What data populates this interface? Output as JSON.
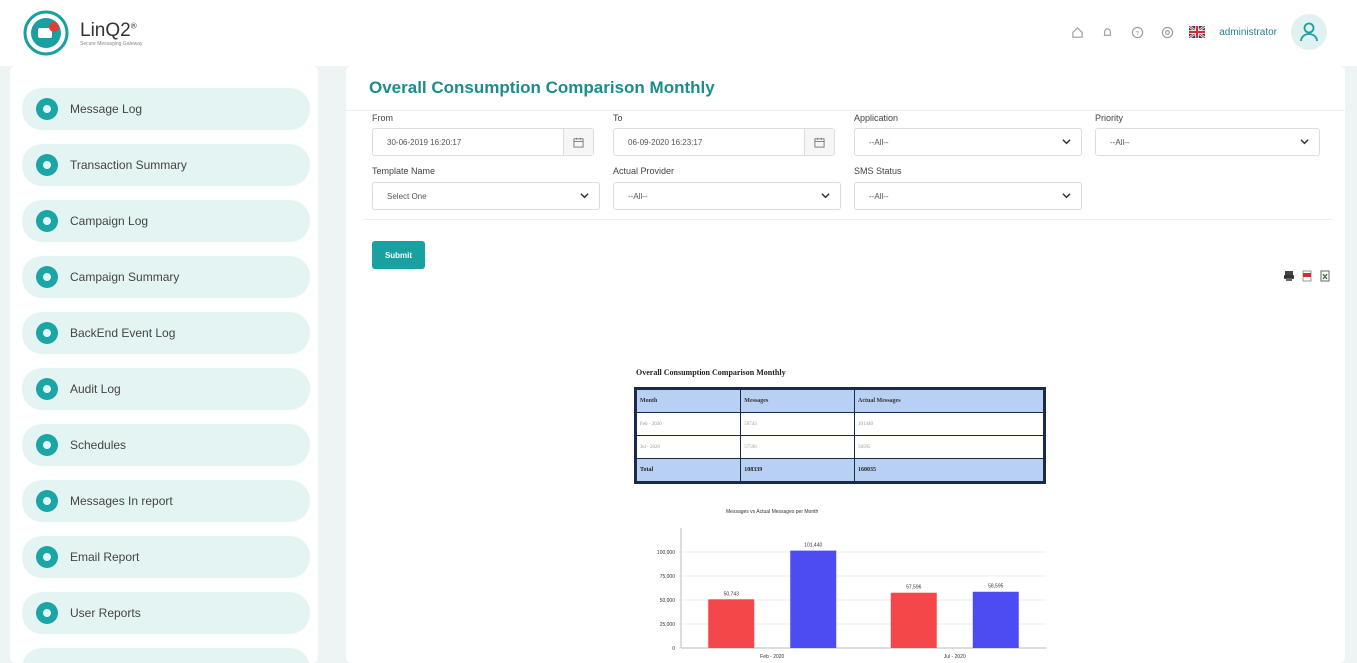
{
  "app": {
    "name": "LinQ2",
    "tagline": "Secure Messaging Gateway"
  },
  "header": {
    "user": "administrator"
  },
  "sidebar": {
    "items": [
      {
        "label": "Message Log"
      },
      {
        "label": "Transaction Summary"
      },
      {
        "label": "Campaign Log"
      },
      {
        "label": "Campaign Summary"
      },
      {
        "label": "BackEnd Event Log"
      },
      {
        "label": "Audit Log"
      },
      {
        "label": "Schedules"
      },
      {
        "label": "Messages In report"
      },
      {
        "label": "Email Report"
      },
      {
        "label": "User Reports"
      }
    ]
  },
  "page": {
    "title": "Overall Consumption Comparison Monthly"
  },
  "form": {
    "from": {
      "label": "From",
      "value": "30-06-2019 16:20:17"
    },
    "to": {
      "label": "To",
      "value": "06-09-2020 16:23:17"
    },
    "application": {
      "label": "Application",
      "value": "--All--"
    },
    "priority": {
      "label": "Priority",
      "value": "--All--"
    },
    "template": {
      "label": "Template Name",
      "value": "Select One"
    },
    "provider": {
      "label": "Actual Provider",
      "value": "--All--"
    },
    "sms_status": {
      "label": "SMS Status",
      "value": "--All--"
    },
    "submit": "Submit"
  },
  "report": {
    "title": "Overall Consumption Comparison Monthly",
    "headers": [
      "Month",
      "Messages",
      "Actual Messages"
    ],
    "rows": [
      [
        "Feb - 2020",
        "50743",
        "101440"
      ],
      [
        "Jul - 2020",
        "57596",
        "58595"
      ]
    ],
    "total": [
      "Total",
      "108339",
      "160035"
    ]
  },
  "chart_data": {
    "type": "bar",
    "title": "Messages vs Actual Messages per Month",
    "categories": [
      "Feb - 2020",
      "Jul - 2020"
    ],
    "series": [
      {
        "values": [
          50743,
          57596
        ],
        "color": "#f4474a"
      },
      {
        "values": [
          101440,
          58595
        ],
        "color": "#4b4df2"
      }
    ],
    "data_labels": [
      [
        "50,743",
        "57,596"
      ],
      [
        "101,440",
        "58,595"
      ]
    ],
    "ylim": [
      0,
      125000
    ],
    "yticks": [
      "0",
      "25,000",
      "50,000",
      "75,000",
      "100,000"
    ],
    "ytick_values": [
      0,
      25000,
      50000,
      75000,
      100000
    ]
  },
  "colors": {
    "accent": "#1aa0a0",
    "sidebar_item_bg": "#e4f4f3"
  }
}
